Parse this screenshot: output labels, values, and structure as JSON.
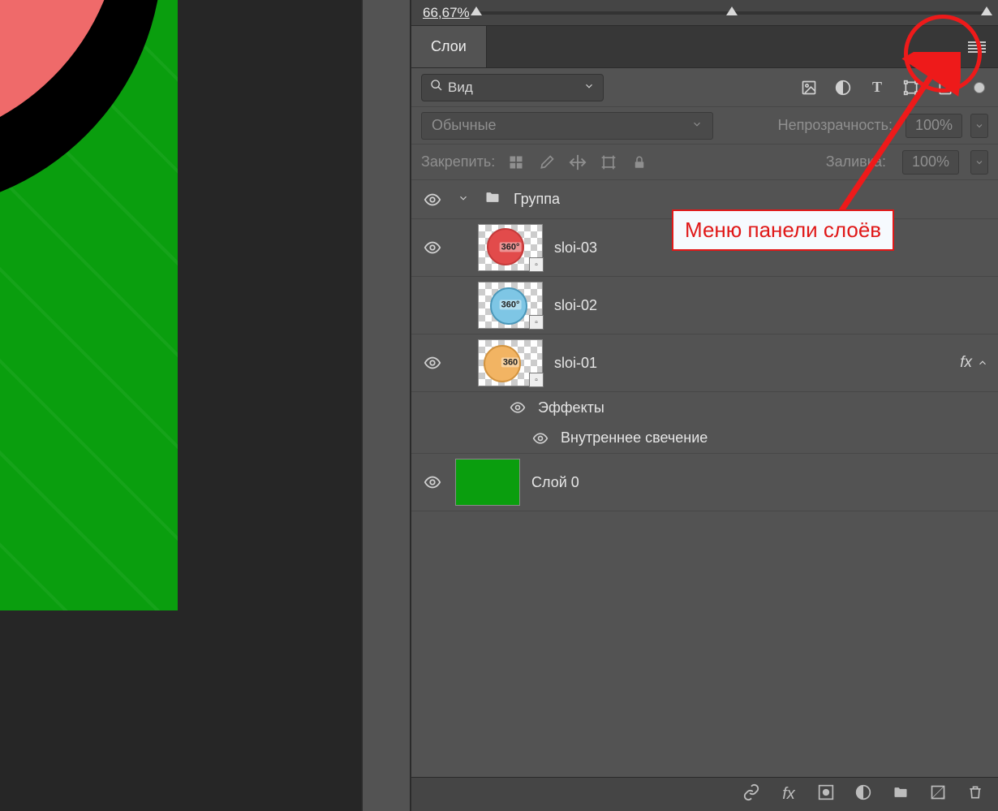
{
  "zoom": {
    "value": "66,67%"
  },
  "panel": {
    "tab": "Слои"
  },
  "search": {
    "placeholder": "Вид"
  },
  "blend": {
    "mode": "Обычные",
    "opacity_label": "Непрозрачность:",
    "opacity_value": "100%"
  },
  "lock": {
    "label": "Закрепить:",
    "fill_label": "Заливка:",
    "fill_value": "100%"
  },
  "group": {
    "name": "Группа"
  },
  "layers": [
    {
      "name": "sloi-03"
    },
    {
      "name": "sloi-02"
    },
    {
      "name": "sloi-01"
    },
    {
      "name": "Слой 0"
    }
  ],
  "fx": {
    "indicator": "fx",
    "effects_label": "Эффекты",
    "inner_glow": "Внутреннее свечение"
  },
  "annotation": {
    "label": "Меню панели слоёв"
  }
}
